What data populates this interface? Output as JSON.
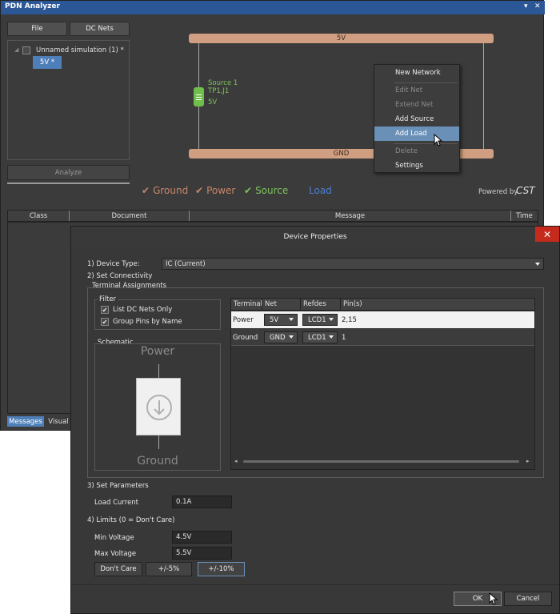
{
  "pdn": {
    "title": "PDN Analyzer",
    "file_button": "File",
    "dc_nets_button": "DC Nets",
    "tree": {
      "simulation": "Unnamed simulation (1) *",
      "net": "5V *"
    },
    "analyze_button": "Analyze",
    "schematic": {
      "power_rail": "5V",
      "ground_rail": "GND",
      "source_name": "Source 1",
      "source_refs": "TP1,J1",
      "source_net": "5V"
    },
    "context_menu": {
      "items": [
        {
          "label": "New Network",
          "enabled": true
        },
        {
          "label": "Edit Net",
          "enabled": false
        },
        {
          "label": "Extend Net",
          "enabled": false
        },
        {
          "label": "Add Source",
          "enabled": true
        },
        {
          "label": "Add Load",
          "enabled": true
        },
        {
          "label": "Delete",
          "enabled": false
        },
        {
          "label": "Settings",
          "enabled": true
        }
      ],
      "highlighted": "Add Load"
    },
    "legend": {
      "ground": "Ground",
      "power": "Power",
      "source": "Source",
      "load": "Load"
    },
    "powered_by": "Powered by",
    "cst_logo": "CST",
    "messages": {
      "columns": [
        "Class",
        "Document",
        "Message",
        "Time"
      ],
      "tabs": [
        "Messages",
        "Visual"
      ]
    }
  },
  "dialog": {
    "title": "Device Properties",
    "device_type_label": "1) Device Type:",
    "device_type_value": "IC (Current)",
    "set_connectivity": "2) Set Connectivity",
    "terminal_assignments": "Terminal Assignments",
    "filter_title": "Filter",
    "filter_list_dc": "List DC Nets Only",
    "filter_group_pins": "Group Pins by Name",
    "schematic_title": "Schematic",
    "schematic_power": "Power",
    "schematic_ground": "Ground",
    "terminal_columns": [
      "Terminal",
      "Net",
      "Refdes",
      "Pin(s)"
    ],
    "terminals": [
      {
        "terminal": "Power",
        "net": "5V",
        "refdes": "LCD1",
        "pins": "2,15"
      },
      {
        "terminal": "Ground",
        "net": "GND",
        "refdes": "LCD1",
        "pins": "1"
      }
    ],
    "set_parameters": "3) Set Parameters",
    "load_current_label": "Load Current",
    "load_current_value": "0.1A",
    "limits_label": "4) Limits (0 = Don't Care)",
    "min_voltage_label": "Min Voltage",
    "min_voltage_value": "4.5V",
    "max_voltage_label": "Max Voltage",
    "max_voltage_value": "5.5V",
    "dont_care_button": "Don't Care",
    "pm5_button": "+/-5%",
    "pm10_button": "+/-10%",
    "ok_button": "OK",
    "cancel_button": "Cancel"
  },
  "colors": {
    "title_bar": "#2b5797",
    "rail": "#d09e80",
    "ground_legend": "#c8876a",
    "source_legend": "#7ec45a",
    "load_legend": "#4a7fd4",
    "highlight": "#6a90b8",
    "close_button": "#c42b1c"
  }
}
